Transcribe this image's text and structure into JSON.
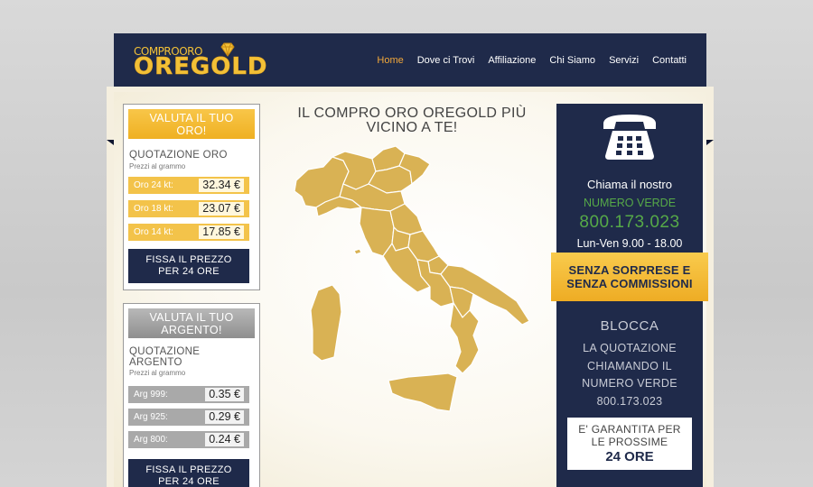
{
  "colors": {
    "navy": "#1f2a4a",
    "gold": "#f3c34a",
    "accent_orange": "#f2a83a",
    "green": "#56a948",
    "silver": "#a9a9a9"
  },
  "header": {
    "logo_top": "COMPROORO",
    "logo_main": "OREGOLD",
    "nav": [
      {
        "label": "Home",
        "active": true
      },
      {
        "label": "Dove ci Trovi"
      },
      {
        "label": "Affiliazione"
      },
      {
        "label": "Chi Siamo"
      },
      {
        "label": "Servizi"
      },
      {
        "label": "Contatti"
      }
    ]
  },
  "gold_panel": {
    "head_line1": "VALUTA IL TUO",
    "head_line2": "ORO!",
    "title": "QUOTAZIONE ORO",
    "subtitle": "Prezzi al grammo",
    "prices": [
      {
        "label": "Oro 24 kt:",
        "value": "32.34 €"
      },
      {
        "label": "Oro 18 kt:",
        "value": "23.07 €"
      },
      {
        "label": "Oro 14 kt:",
        "value": "17.85 €"
      }
    ],
    "button_line1": "FISSA IL PREZZO",
    "button_line2": "PER 24 ORE"
  },
  "silver_panel": {
    "head_line1": "VALUTA IL TUO",
    "head_line2": "ARGENTO!",
    "title_line1": "QUOTAZIONE",
    "title_line2": "ARGENTO",
    "subtitle": "Prezzi al grammo",
    "prices": [
      {
        "label": "Arg 999:",
        "value": "0.35 €"
      },
      {
        "label": "Arg 925:",
        "value": "0.29 €"
      },
      {
        "label": "Arg 800:",
        "value": "0.24 €"
      }
    ],
    "button_line1": "FISSA IL PREZZO",
    "button_line2": "PER 24 ORE"
  },
  "center": {
    "title_line1": "IL COMPRO ORO OREGOLD PIÙ",
    "title_line2": "VICINO A TE!"
  },
  "contact": {
    "call_line": "Chiama il nostro",
    "green_label": "NUMERO VERDE",
    "phone": "800.173.023",
    "hours": "Lun-Ven 9.00 - 18.00",
    "ribbon_line1": "SENZA SORPRESE E",
    "ribbon_line2": "SENZA COMMISSIONI",
    "blocca_title": "BLOCCA",
    "blocca_lines": [
      "LA QUOTAZIONE",
      "CHIAMANDO IL",
      "NUMERO VERDE",
      "800.173.023"
    ],
    "guarantee_line1": "E' GARANTITA PER",
    "guarantee_line2": "LE PROSSIME",
    "guarantee_line3": "24 ORE"
  }
}
